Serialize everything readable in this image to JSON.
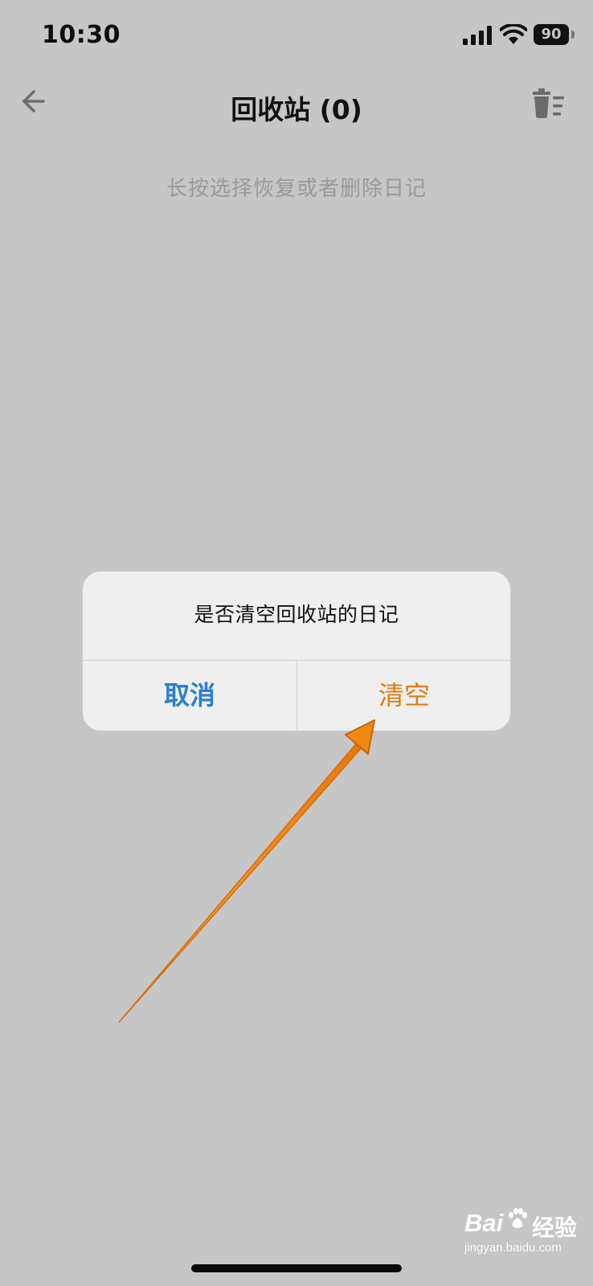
{
  "status_bar": {
    "time": "10:30",
    "battery_level": "90",
    "icons": [
      "signal-icon",
      "wifi-icon",
      "battery-icon"
    ]
  },
  "nav": {
    "title": "回收站 (0)",
    "back_icon": "arrow-left-icon",
    "trash_icon": "trash-list-icon"
  },
  "hint": "长按选择恢复或者删除日记",
  "dialog": {
    "message": "是否清空回收站的日记",
    "cancel_label": "取消",
    "confirm_label": "清空"
  },
  "colors": {
    "background": "#c6c6c6",
    "dialog_bg": "#efefef",
    "cancel": "#2a7fd0",
    "confirm": "#e07b10",
    "annotation_arrow": "#f08a12"
  },
  "watermark": {
    "brand_left": "Bai",
    "brand_right": "经验",
    "url": "jingyan.baidu.com"
  }
}
